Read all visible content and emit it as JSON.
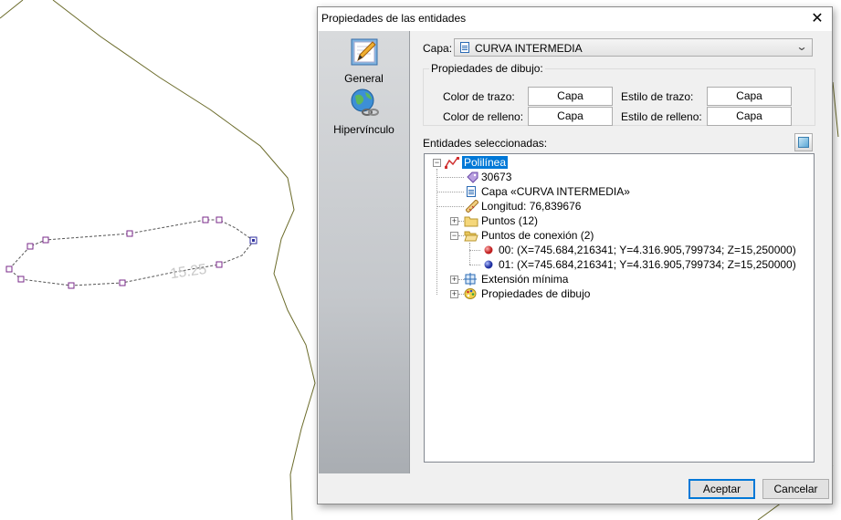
{
  "dialog": {
    "title": "Propiedades de las entidades",
    "close_glyph": "✕"
  },
  "sidebar": {
    "items": [
      {
        "label": "General",
        "icon": "pencil-document-icon"
      },
      {
        "label": "Hipervínculo",
        "icon": "globe-link-icon"
      }
    ]
  },
  "capa": {
    "label": "Capa:",
    "value": "CURVA INTERMEDIA"
  },
  "drawing_props": {
    "legend": "Propiedades de dibujo:",
    "stroke_color_label": "Color de trazo:",
    "stroke_color_value": "Capa",
    "stroke_style_label": "Estilo de trazo:",
    "stroke_style_value": "Capa",
    "fill_color_label": "Color de relleno:",
    "fill_color_value": "Capa",
    "fill_style_label": "Estilo de relleno:",
    "fill_style_value": "Capa"
  },
  "selection": {
    "label": "Entidades seleccionadas:"
  },
  "tree": {
    "root": "Polilínea",
    "id": "30673",
    "layer": "Capa «CURVA INTERMEDIA»",
    "length": "Longitud: 76,839676",
    "points": "Puntos (12)",
    "connection_points": "Puntos de conexión (2)",
    "conn_0": "00: (X=745.684,216341; Y=4.316.905,799734; Z=15,250000)",
    "conn_1": "01: (X=745.684,216341; Y=4.316.905,799734; Z=15,250000)",
    "extent": "Extensión mínima",
    "draw_props": "Propiedades de dibujo"
  },
  "buttons": {
    "accept": "Aceptar",
    "cancel": "Cancelar"
  },
  "map": {
    "contour_label": "15.25",
    "selection_color": "#7a2a8a",
    "contour_color": "#6b6b2a"
  },
  "colors": {
    "selection_highlight": "#0078d7",
    "conn_point_0": "#d03030",
    "conn_point_1": "#3050c0"
  }
}
